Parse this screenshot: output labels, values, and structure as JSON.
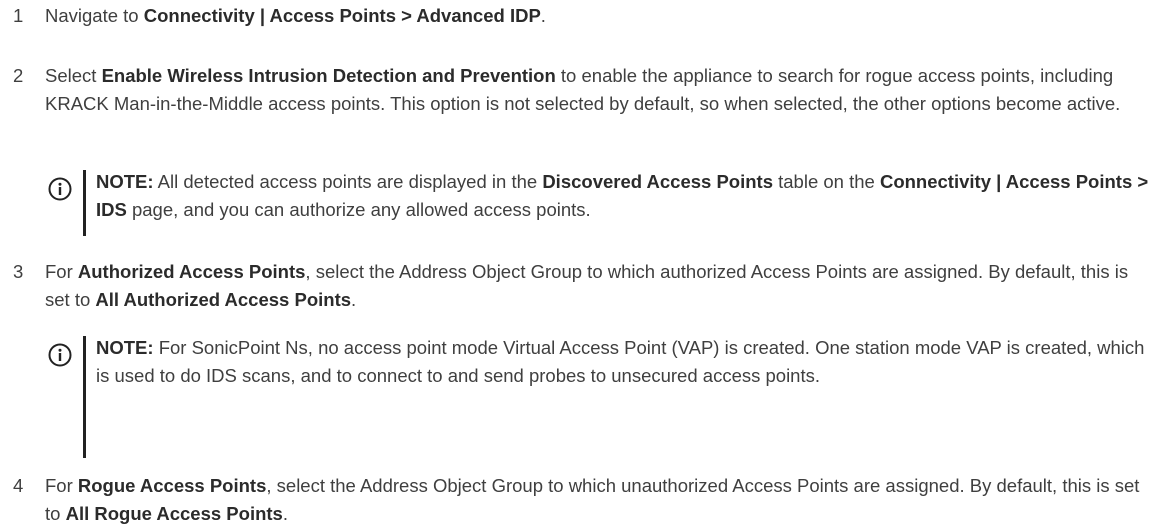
{
  "steps": [
    {
      "number": "1",
      "parts": [
        "Navigate to ",
        "Connectivity | Access Points > Advanced IDP",
        "."
      ]
    },
    {
      "number": "2",
      "parts": [
        "Select ",
        "Enable Wireless Intrusion Detection and Prevention",
        " to enable the appliance to search for rogue access points, including KRACK Man-in-the-Middle access points. This option is not selected by default, so when selected, the other options become active."
      ]
    },
    {
      "number": "3",
      "parts": [
        "For ",
        "Authorized Access Points",
        ", select the Address Object Group to which authorized Access Points are assigned. By default, this is set to ",
        "All Authorized Access Points",
        "."
      ]
    },
    {
      "number": "4",
      "parts": [
        "For ",
        "Rogue Access Points",
        ", select the Address Object Group to which unauthorized Access Points are assigned. By default, this is set to ",
        "All Rogue Access Points",
        "."
      ]
    }
  ],
  "notes": [
    {
      "icon": "info-icon",
      "parts": [
        "NOTE:",
        " All detected access points are displayed in the ",
        "Discovered Access Points",
        " table on the ",
        "Connectivity | Access Points > IDS",
        " page, and you can authorize any allowed access points."
      ]
    },
    {
      "icon": "info-icon",
      "parts": [
        "NOTE:",
        " For SonicPoint Ns, no access point mode Virtual Access Point (VAP) is created. One station mode VAP is created, which is used to do IDS scans, and to connect to and send probes to unsecured access points."
      ]
    }
  ]
}
